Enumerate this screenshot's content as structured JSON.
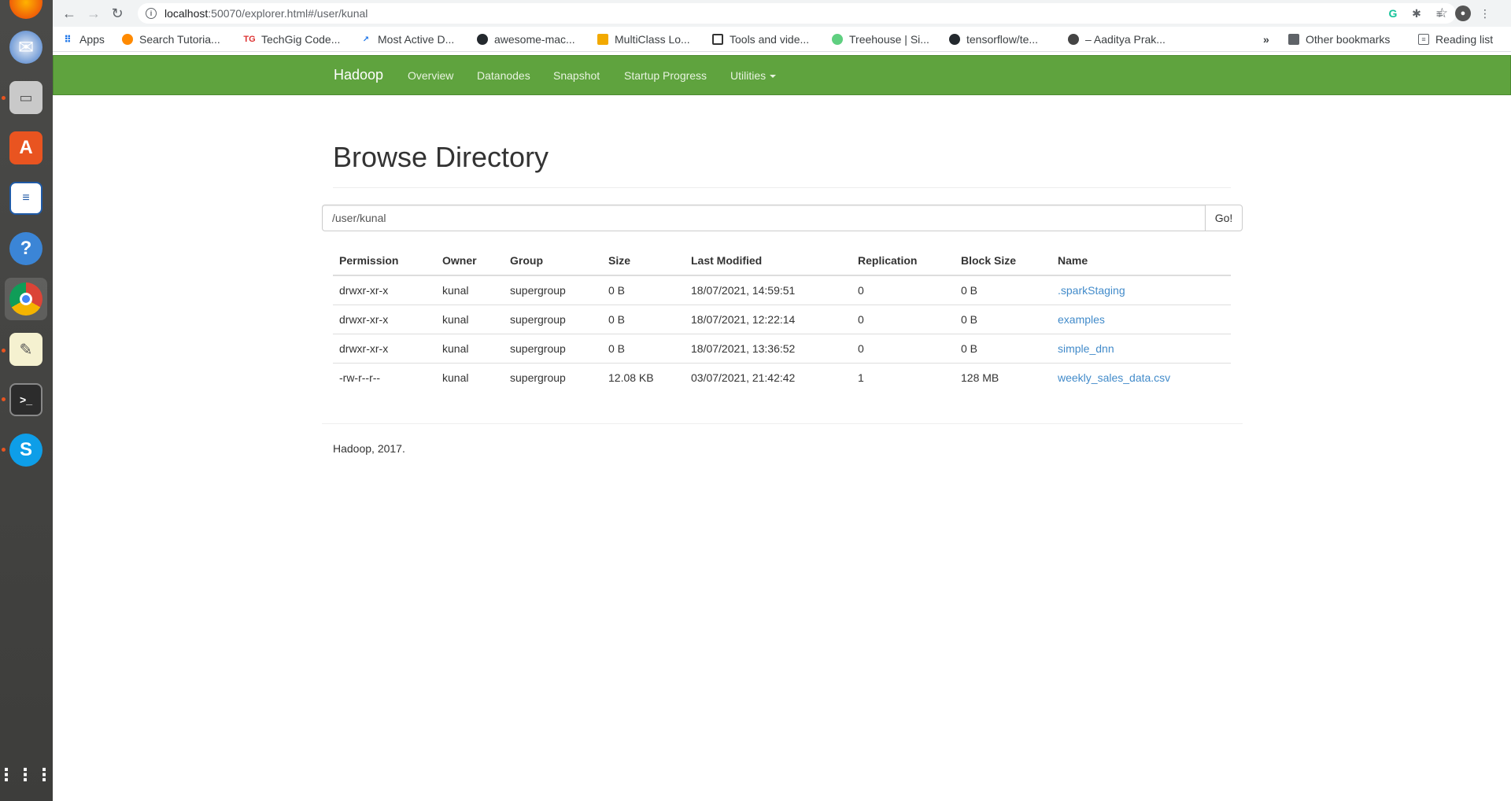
{
  "browser": {
    "url_host": "localhost",
    "url_rest": ":50070/explorer.html#/user/kunal",
    "bookmarks": [
      {
        "label": "Apps"
      },
      {
        "label": "Search Tutoria..."
      },
      {
        "label": "TechGig Code..."
      },
      {
        "label": "Most Active D..."
      },
      {
        "label": "awesome-mac..."
      },
      {
        "label": "MultiClass Lo..."
      },
      {
        "label": "Tools and vide..."
      },
      {
        "label": "Treehouse | Si..."
      },
      {
        "label": "tensorflow/te..."
      },
      {
        "label": "– Aaditya Prak..."
      }
    ],
    "overflow": "»",
    "other_bookmarks": "Other bookmarks",
    "reading_list": "Reading list"
  },
  "navbar": {
    "brand": "Hadoop",
    "links": [
      "Overview",
      "Datanodes",
      "Snapshot",
      "Startup Progress",
      "Utilities"
    ]
  },
  "main": {
    "title": "Browse Directory",
    "path_value": "/user/kunal",
    "go_label": "Go!",
    "columns": [
      "Permission",
      "Owner",
      "Group",
      "Size",
      "Last Modified",
      "Replication",
      "Block Size",
      "Name"
    ],
    "rows": [
      [
        "drwxr-xr-x",
        "kunal",
        "supergroup",
        "0 B",
        "18/07/2021, 14:59:51",
        "0",
        "0 B",
        ".sparkStaging"
      ],
      [
        "drwxr-xr-x",
        "kunal",
        "supergroup",
        "0 B",
        "18/07/2021, 12:22:14",
        "0",
        "0 B",
        "examples"
      ],
      [
        "drwxr-xr-x",
        "kunal",
        "supergroup",
        "0 B",
        "18/07/2021, 13:36:52",
        "0",
        "0 B",
        "simple_dnn"
      ],
      [
        "-rw-r--r--",
        "kunal",
        "supergroup",
        "12.08 KB",
        "03/07/2021, 21:42:42",
        "1",
        "128 MB",
        "weekly_sales_data.csv"
      ]
    ]
  },
  "footer": "Hadoop, 2017.",
  "colors": {
    "navbar": "#5fa33e",
    "link": "#428bca"
  }
}
